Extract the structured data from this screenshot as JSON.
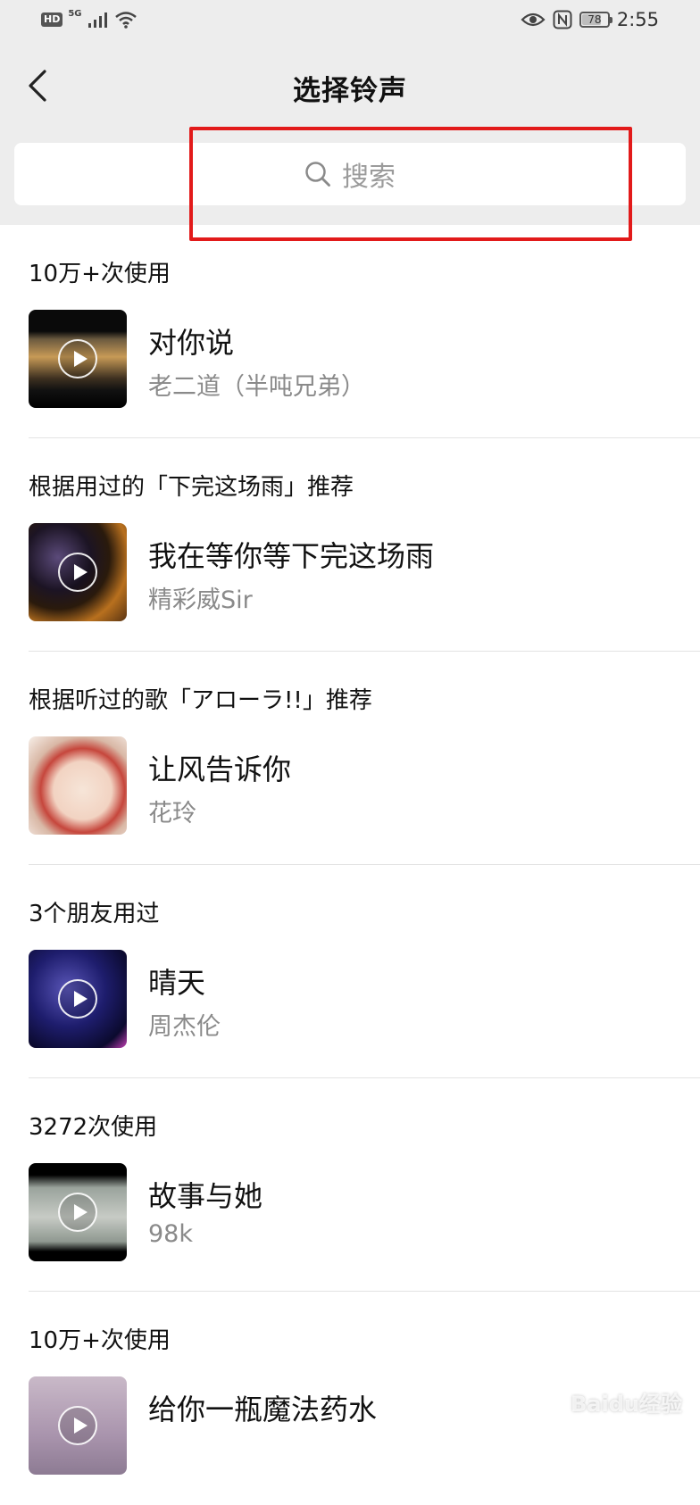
{
  "status_bar": {
    "hd": "HD",
    "network": "5G",
    "battery": "78",
    "battery_level": 0.78,
    "time": "2:55"
  },
  "nav": {
    "title": "选择铃声"
  },
  "search": {
    "placeholder": "搜索"
  },
  "sections": [
    {
      "label": "10万+次使用",
      "song": {
        "title": "对你说",
        "artist": "老二道（半吨兄弟）"
      }
    },
    {
      "label": "根据用过的「下完这场雨」推荐",
      "song": {
        "title": "我在等你等下完这场雨",
        "artist": "精彩威Sir"
      }
    },
    {
      "label": "根据听过的歌「アローラ!!」推荐",
      "song": {
        "title": "让风告诉你",
        "artist": "花玲"
      }
    },
    {
      "label": "3个朋友用过",
      "song": {
        "title": "晴天",
        "artist": "周杰伦"
      }
    },
    {
      "label": "3272次使用",
      "song": {
        "title": "故事与她",
        "artist": "98k"
      }
    },
    {
      "label": "10万+次使用",
      "song": {
        "title": "给你一瓶魔法药水",
        "artist": ""
      }
    }
  ],
  "watermark": "Baidu经验",
  "colors": {
    "header_bg": "#ededed",
    "highlight": "#e21a1a",
    "secondary_text": "#8a8a8a"
  }
}
